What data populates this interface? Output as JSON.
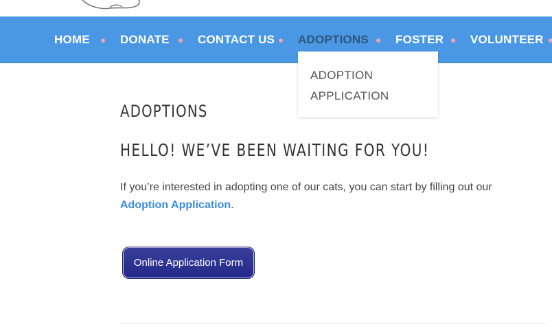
{
  "nav": {
    "items": [
      {
        "label": "HOME"
      },
      {
        "label": "DONATE"
      },
      {
        "label": "CONTACT US"
      },
      {
        "label": "ADOPTIONS"
      },
      {
        "label": "FOSTER"
      },
      {
        "label": "VOLUNTEER"
      }
    ],
    "dropdown": {
      "items": [
        {
          "label": "ADOPTION"
        },
        {
          "label": "APPLICATION"
        }
      ]
    }
  },
  "page": {
    "title": "ADOPTIONS",
    "heading": "HELLO! WE’VE BEEN WAITING FOR YOU!",
    "paragraph_text": "If you’re interested in adopting one of our cats, you can start by filling out our",
    "paragraph_link": "Adoption Application",
    "paragraph_end": "."
  },
  "button": {
    "label": "Online Application Form"
  },
  "colors": {
    "nav_bg": "#4a98e4",
    "nav_dot": "#f4a3b0",
    "link": "#3a8be0",
    "button_bg": "#24288a"
  }
}
